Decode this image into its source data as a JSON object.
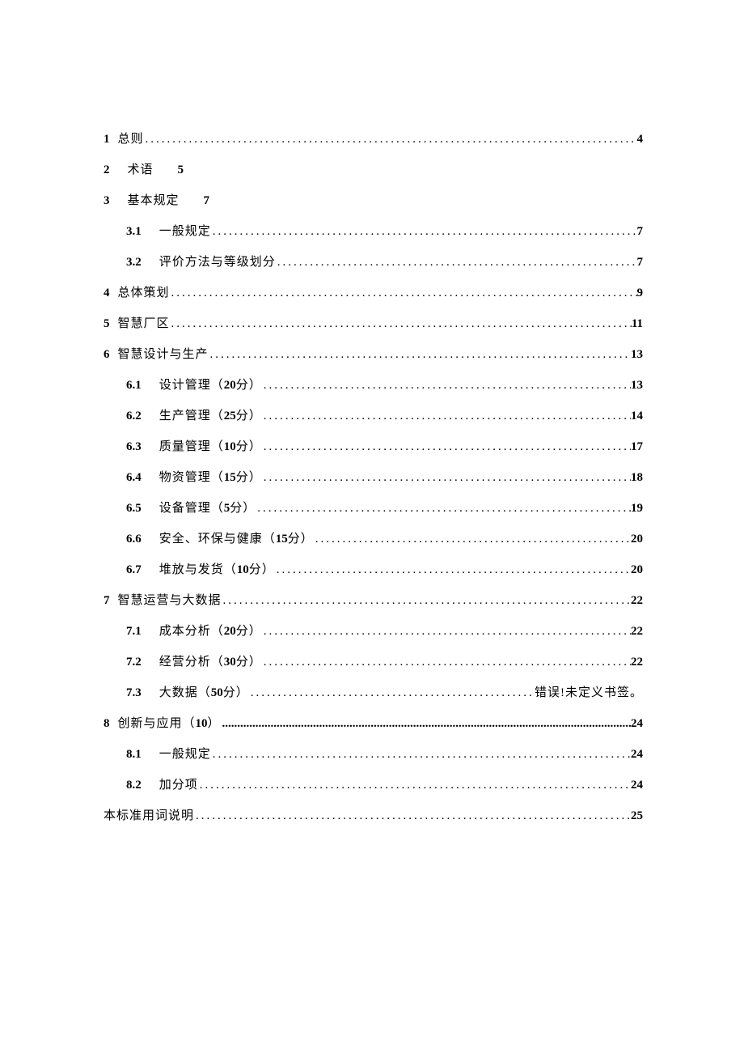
{
  "toc": [
    {
      "level": 1,
      "num": "1",
      "label": "总则",
      "page": "4",
      "leader": true,
      "numBold": true,
      "numSpaced": false
    },
    {
      "level": 1,
      "num": "2",
      "label": "术语",
      "page": "5",
      "leader": false,
      "numBold": true,
      "numSpaced": true
    },
    {
      "level": 1,
      "num": "3",
      "label": "基本规定",
      "page": "7",
      "leader": false,
      "numBold": true,
      "numSpaced": true
    },
    {
      "level": 2,
      "num": "3.1",
      "label": "一般规定",
      "page": "7",
      "leader": true,
      "numBold": true,
      "numSpaced": true
    },
    {
      "level": 2,
      "num": "3.2",
      "label": "评价方法与等级划分",
      "page": "7",
      "leader": true,
      "numBold": true,
      "numSpaced": true
    },
    {
      "level": 1,
      "num": "4",
      "label": "总体策划",
      "page": "9",
      "leader": true,
      "numBold": true,
      "numSpaced": false
    },
    {
      "level": 1,
      "num": "5",
      "label": "智慧厂区",
      "page": "11",
      "leader": true,
      "numBold": true,
      "numSpaced": false
    },
    {
      "level": 1,
      "num": "6",
      "label": "智慧设计与生产",
      "page": "13",
      "leader": true,
      "numBold": true,
      "numSpaced": false
    },
    {
      "level": 2,
      "num": "6.1",
      "label": "设计管理（",
      "boldSuffix": "20",
      "labelSuffix": "分）",
      "page": "13",
      "leader": true,
      "numBold": true,
      "numSpaced": true
    },
    {
      "level": 2,
      "num": "6.2",
      "label": "生产管理（",
      "boldSuffix": "25",
      "labelSuffix": "分）",
      "page": "14",
      "leader": true,
      "numBold": true,
      "numSpaced": true
    },
    {
      "level": 2,
      "num": "6.3",
      "label": "质量管理（",
      "boldSuffix": "10",
      "labelSuffix": "分）",
      "page": "17",
      "leader": true,
      "numBold": true,
      "numSpaced": true
    },
    {
      "level": 2,
      "num": "6.4",
      "label": "物资管理（",
      "boldSuffix": "15",
      "labelSuffix": "分）",
      "page": "18",
      "leader": true,
      "numBold": true,
      "numSpaced": true
    },
    {
      "level": 2,
      "num": "6.5",
      "label": "设备管理（",
      "boldSuffix": "5",
      "labelSuffix": "分）",
      "page": "19",
      "leader": true,
      "numBold": true,
      "numSpaced": true
    },
    {
      "level": 2,
      "num": "6.6",
      "label": "安全、环保与健康（",
      "boldSuffix": "15",
      "labelSuffix": "分）",
      "page": "20",
      "leader": true,
      "numBold": true,
      "numSpaced": true
    },
    {
      "level": 2,
      "num": "6.7",
      "label": "堆放与发货（",
      "boldSuffix": "10",
      "labelSuffix": "分）",
      "page": "20",
      "leader": true,
      "numBold": true,
      "numSpaced": true
    },
    {
      "level": 1,
      "num": "7",
      "label": "智慧运营与大数据",
      "page": "22",
      "leader": true,
      "numBold": true,
      "numSpaced": false
    },
    {
      "level": 2,
      "num": "7.1",
      "label": "成本分析（",
      "boldSuffix": "20",
      "labelSuffix": "分）",
      "page": "22",
      "leader": true,
      "numBold": true,
      "numSpaced": true
    },
    {
      "level": 2,
      "num": "7.2",
      "label": "经营分析（",
      "boldSuffix": "30",
      "labelSuffix": "分）",
      "page": "22",
      "leader": true,
      "numBold": true,
      "numSpaced": true
    },
    {
      "level": 2,
      "num": "7.3",
      "label": "大数据（",
      "boldSuffix": "50",
      "labelSuffix": "分）",
      "pageText": "错误!未定义书签。",
      "leader": true,
      "numBold": true,
      "numSpaced": true,
      "errFmt": true
    },
    {
      "level": 1,
      "num": "8",
      "label": "创新与应用（",
      "boldSuffix": "10",
      "labelSuffix": "）",
      "page": "24",
      "leader": true,
      "numBold": true,
      "numSpaced": false,
      "tightLeader": true
    },
    {
      "level": 2,
      "num": "8.1",
      "label": "一般规定",
      "page": "24",
      "leader": true,
      "numBold": true,
      "numSpaced": true
    },
    {
      "level": 2,
      "num": "8.2",
      "label": "加分项",
      "page": "24",
      "leader": true,
      "numBold": true,
      "numSpaced": true
    },
    {
      "level": 1,
      "num": "",
      "label": "本标准用词说明",
      "page": "25",
      "leader": true,
      "numBold": false,
      "numSpaced": false
    }
  ],
  "leaderChar": "."
}
